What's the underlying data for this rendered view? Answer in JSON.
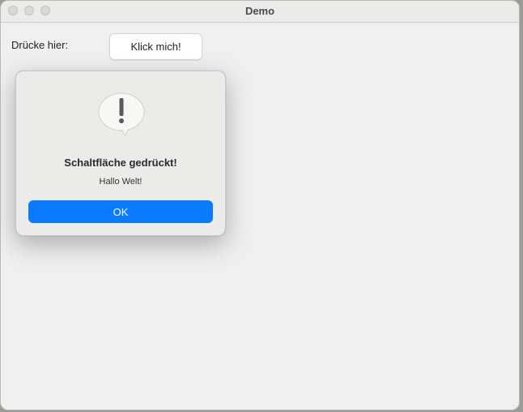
{
  "window": {
    "title": "Demo"
  },
  "main": {
    "prompt_label": "Drücke hier:",
    "button_label": "Klick mich!"
  },
  "alert": {
    "icon": "exclamation-speech-bubble-icon",
    "title": "Schaltfläche gedrückt!",
    "message": "Hallo Welt!",
    "ok_label": "OK",
    "ok_color": "#0a7aff"
  }
}
